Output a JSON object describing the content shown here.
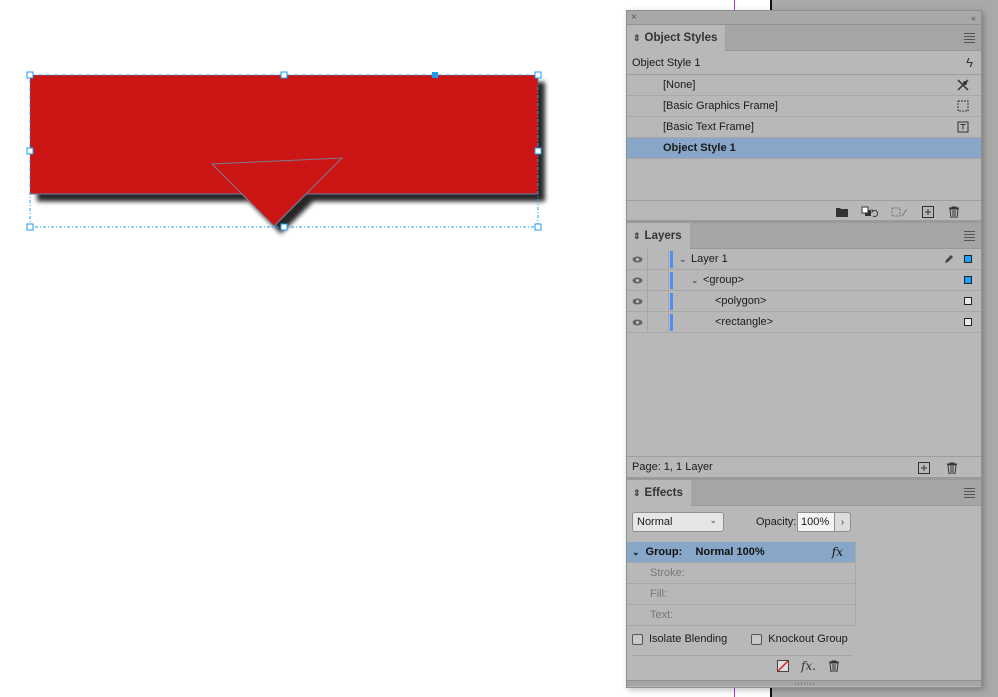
{
  "canvas": {
    "fill_color": "#cc1417",
    "selection_color": "#1d9bf0",
    "guide_color": "#b235e0"
  },
  "dock": {
    "close_glyph": "×",
    "collapse_glyph": "‹‹"
  },
  "object_styles": {
    "tab_label": "Object Styles",
    "current_style": "Object Style 1",
    "items": [
      {
        "label": "[None]",
        "icon": "no-style-icon"
      },
      {
        "label": "[Basic Graphics Frame]",
        "icon": "graphics-frame-icon"
      },
      {
        "label": "[Basic Text Frame]",
        "icon": "text-frame-icon"
      },
      {
        "label": "Object Style 1",
        "icon": "",
        "selected": true
      }
    ],
    "footer_icons": [
      "new-folder-icon",
      "clear-overrides-icon",
      "clear-attributes-icon",
      "new-style-icon",
      "trash-icon"
    ]
  },
  "layers": {
    "tab_label": "Layers",
    "items": [
      {
        "name": "Layer 1",
        "level": 0,
        "expanded": true,
        "selected_box": true,
        "pen": true
      },
      {
        "name": "<group>",
        "level": 1,
        "expanded": true,
        "selected_box": true
      },
      {
        "name": "<polygon>",
        "level": 2,
        "selected_box": false
      },
      {
        "name": "<rectangle>",
        "level": 2,
        "selected_box": false
      }
    ],
    "status": "Page: 1, 1 Layer",
    "layer_color": "#4b8ff7"
  },
  "effects": {
    "tab_label": "Effects",
    "blend_mode": "Normal",
    "opacity_label": "Opacity:",
    "opacity_value": "100%",
    "target_row": {
      "target": "Group:",
      "value": "Normal 100%",
      "fx": "fx"
    },
    "sub_rows": [
      "Stroke:",
      "Fill:",
      "Text:"
    ],
    "isolate_blending": {
      "label": "Isolate Blending",
      "checked": false
    },
    "knockout_group": {
      "label": "Knockout Group",
      "checked": false
    }
  }
}
